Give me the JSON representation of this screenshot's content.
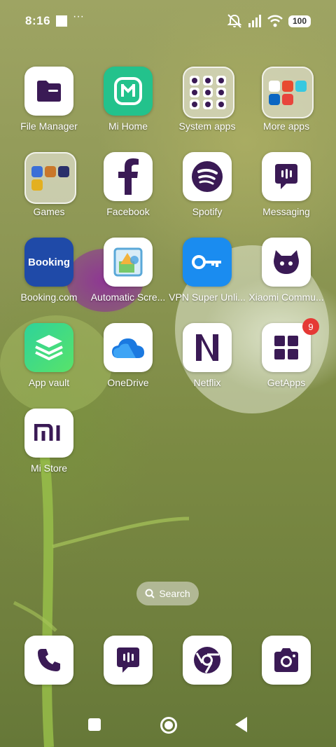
{
  "status_bar": {
    "time": "8:16",
    "more": "···",
    "battery": "100"
  },
  "apps": {
    "file_manager": "File Manager",
    "mi_home": "Mi Home",
    "system_apps": "System apps",
    "more_apps": "More apps",
    "games": "Games",
    "facebook": "Facebook",
    "spotify": "Spotify",
    "messaging": "Messaging",
    "booking": "Booking.com",
    "booking_logo": "Booking",
    "auto_screen": "Automatic Scre...",
    "vpn": "VPN Super Unli...",
    "xiaomi_community": "Xiaomi Commu...",
    "app_vault": "App vault",
    "onedrive": "OneDrive",
    "netflix": "Netflix",
    "getapps": "GetApps",
    "getapps_badge": "9",
    "mi_store": "Mi Store"
  },
  "search": {
    "label": "Search"
  },
  "colors": {
    "icon_glyph": "#3a1a55",
    "mi_home_green": "#23c28c",
    "booking_blue": "#1f4aa8",
    "vpn_blue": "#1a8cf0",
    "badge_red": "#e53935"
  },
  "icons": {
    "dock": [
      "phone-icon",
      "messaging-icon",
      "chrome-icon",
      "camera-icon"
    ],
    "nav": [
      "recents-button",
      "home-button",
      "back-button"
    ]
  }
}
